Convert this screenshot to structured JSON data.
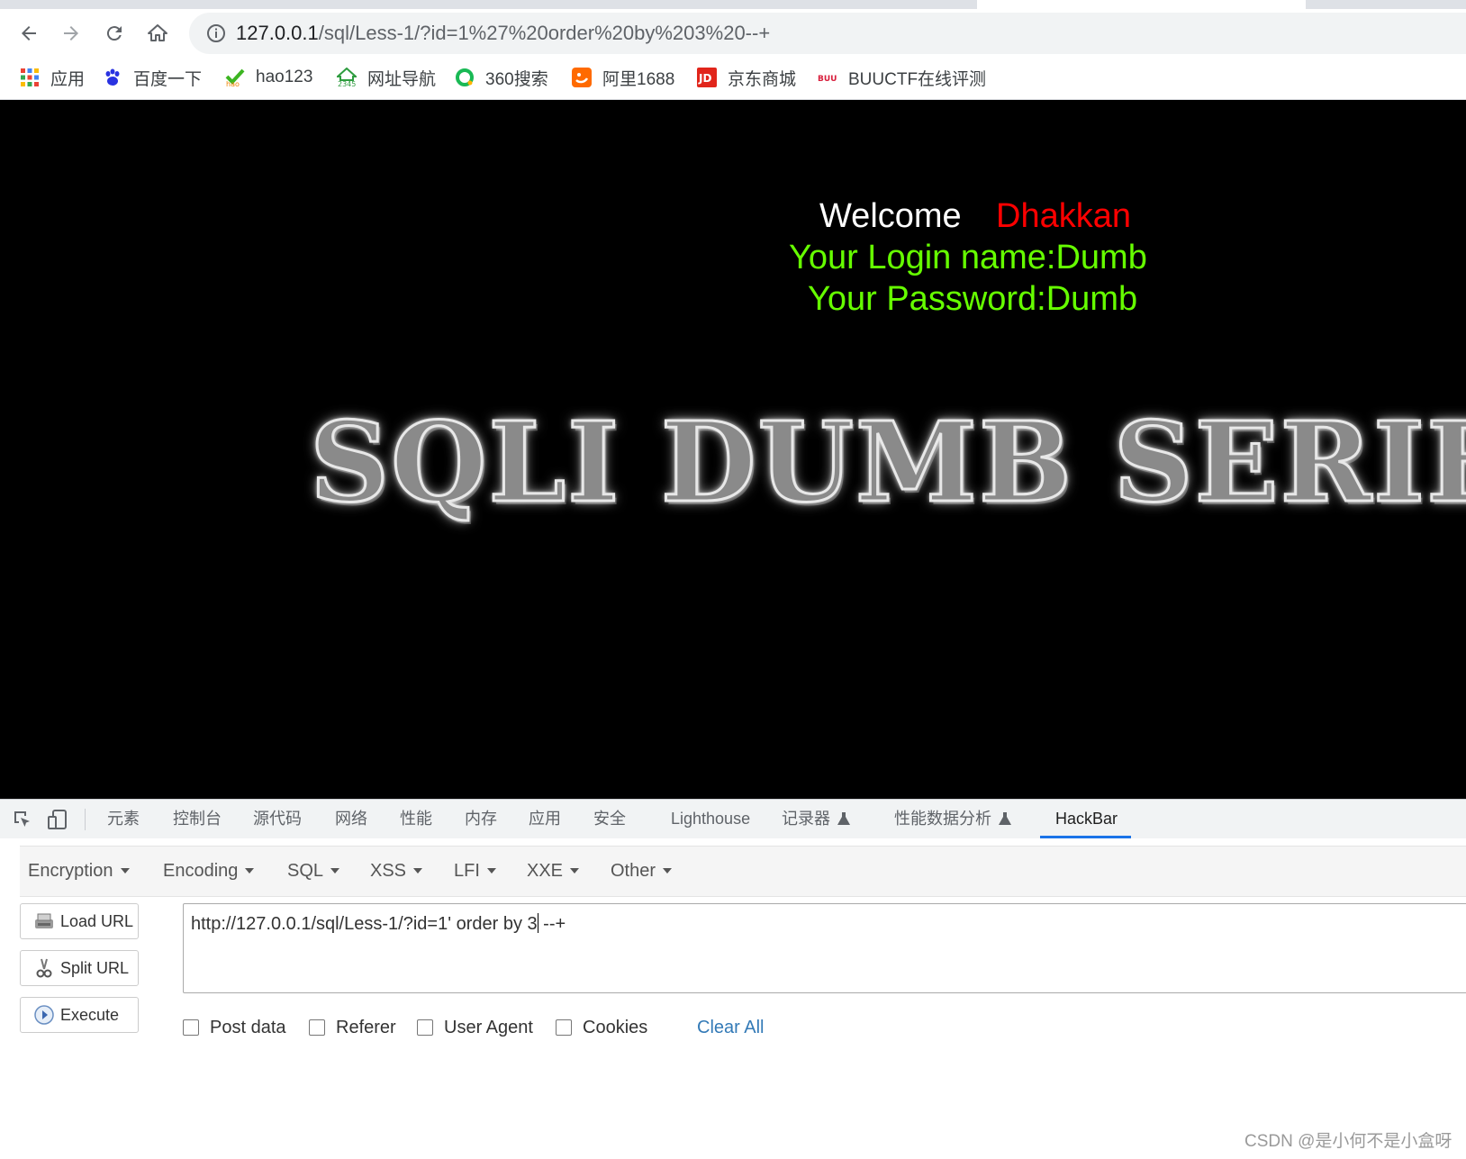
{
  "browser": {
    "url": {
      "host": "127.0.0.1",
      "path": "/sql/Less-1/?id=1%27%20order%20by%203%20--+"
    },
    "bookmarks": [
      {
        "label": "应用",
        "icon": "apps-grid-icon"
      },
      {
        "label": "百度一下",
        "icon": "baidu-paw-icon"
      },
      {
        "label": "hao123",
        "icon": "hao123-icon"
      },
      {
        "label": "网址导航",
        "icon": "2345-nav-icon"
      },
      {
        "label": "360搜索",
        "icon": "360-search-icon"
      },
      {
        "label": "阿里1688",
        "icon": "alibaba-1688-icon"
      },
      {
        "label": "京东商城",
        "icon": "jd-icon"
      },
      {
        "label": "BUUCTF在线评测",
        "icon": "buuctf-icon"
      }
    ]
  },
  "page": {
    "welcome": "Welcome",
    "name": "Dhakkan",
    "login_line": "Your Login name:Dumb",
    "password_line": "Your Password:Dumb",
    "banner": "SQLI DUMB SERIES"
  },
  "devtools": {
    "tabs": [
      "元素",
      "控制台",
      "源代码",
      "网络",
      "性能",
      "内存",
      "应用",
      "安全",
      "Lighthouse",
      "记录器",
      "性能数据分析",
      "HackBar"
    ],
    "active_tab": "HackBar"
  },
  "hackbar": {
    "menu": [
      "Encryption",
      "Encoding",
      "SQL",
      "XSS",
      "LFI",
      "XXE",
      "Other"
    ],
    "buttons": {
      "load": "Load URL",
      "split": "Split URL",
      "execute": "Execute"
    },
    "url_before_cursor": "http://127.0.0.1/sql/Less-1/?id=1' order by 3",
    "url_after_cursor": " --+",
    "checkboxes": [
      "Post data",
      "Referer",
      "User Agent",
      "Cookies"
    ],
    "clear_all": "Clear All"
  },
  "watermark": "CSDN @是小何不是小盒呀",
  "colors": {
    "accent_blue": "#1a73e8",
    "login_green": "#66ff00",
    "name_red": "#ff0000",
    "link_blue": "#337ab7"
  }
}
